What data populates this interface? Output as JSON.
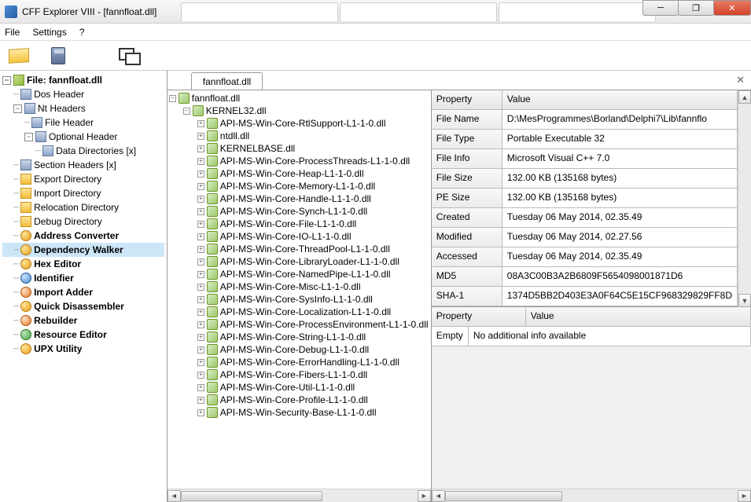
{
  "window": {
    "title": "CFF Explorer VIII - [fannfloat.dll]"
  },
  "menu": {
    "file": "File",
    "settings": "Settings",
    "help": "?"
  },
  "tab": {
    "label": "fannfloat.dll"
  },
  "leftTree": {
    "root": "File: fannfloat.dll",
    "items": [
      "Dos Header",
      "Nt Headers",
      "File Header",
      "Optional Header",
      "Data Directories [x]",
      "Section Headers [x]",
      "Export Directory",
      "Import Directory",
      "Relocation Directory",
      "Debug Directory",
      "Address Converter",
      "Dependency Walker",
      "Hex Editor",
      "Identifier",
      "Import Adder",
      "Quick Disassembler",
      "Rebuilder",
      "Resource Editor",
      "UPX Utility"
    ]
  },
  "midTree": {
    "root": "fannfloat.dll",
    "child": "KERNEL32.dll",
    "leaves": [
      "API-MS-Win-Core-RtlSupport-L1-1-0.dll",
      "ntdll.dll",
      "KERNELBASE.dll",
      "API-MS-Win-Core-ProcessThreads-L1-1-0.dll",
      "API-MS-Win-Core-Heap-L1-1-0.dll",
      "API-MS-Win-Core-Memory-L1-1-0.dll",
      "API-MS-Win-Core-Handle-L1-1-0.dll",
      "API-MS-Win-Core-Synch-L1-1-0.dll",
      "API-MS-Win-Core-File-L1-1-0.dll",
      "API-MS-Win-Core-IO-L1-1-0.dll",
      "API-MS-Win-Core-ThreadPool-L1-1-0.dll",
      "API-MS-Win-Core-LibraryLoader-L1-1-0.dll",
      "API-MS-Win-Core-NamedPipe-L1-1-0.dll",
      "API-MS-Win-Core-Misc-L1-1-0.dll",
      "API-MS-Win-Core-SysInfo-L1-1-0.dll",
      "API-MS-Win-Core-Localization-L1-1-0.dll",
      "API-MS-Win-Core-ProcessEnvironment-L1-1-0.dll",
      "API-MS-Win-Core-String-L1-1-0.dll",
      "API-MS-Win-Core-Debug-L1-1-0.dll",
      "API-MS-Win-Core-ErrorHandling-L1-1-0.dll",
      "API-MS-Win-Core-Fibers-L1-1-0.dll",
      "API-MS-Win-Core-Util-L1-1-0.dll",
      "API-MS-Win-Core-Profile-L1-1-0.dll",
      "API-MS-Win-Security-Base-L1-1-0.dll"
    ]
  },
  "props": {
    "header": {
      "k": "Property",
      "v": "Value"
    },
    "rows": [
      {
        "k": "File Name",
        "v": "D:\\MesProgrammes\\Borland\\Delphi7\\Lib\\fannflo"
      },
      {
        "k": "File Type",
        "v": "Portable Executable 32"
      },
      {
        "k": "File Info",
        "v": "Microsoft Visual C++ 7.0"
      },
      {
        "k": "File Size",
        "v": "132.00 KB (135168 bytes)"
      },
      {
        "k": "PE Size",
        "v": "132.00 KB (135168 bytes)"
      },
      {
        "k": "Created",
        "v": "Tuesday 06 May 2014, 02.35.49"
      },
      {
        "k": "Modified",
        "v": "Tuesday 06 May 2014, 02.27.56"
      },
      {
        "k": "Accessed",
        "v": "Tuesday 06 May 2014, 02.35.49"
      },
      {
        "k": "MD5",
        "v": "08A3C00B3A2B6809F5654098001871D6"
      },
      {
        "k": "SHA-1",
        "v": "1374D5BB2D403E3A0F64C5E15CF968329829FF8D"
      }
    ]
  },
  "props2": {
    "header": {
      "k": "Property",
      "v": "Value"
    },
    "row": {
      "k": "Empty",
      "v": "No additional info available"
    }
  }
}
